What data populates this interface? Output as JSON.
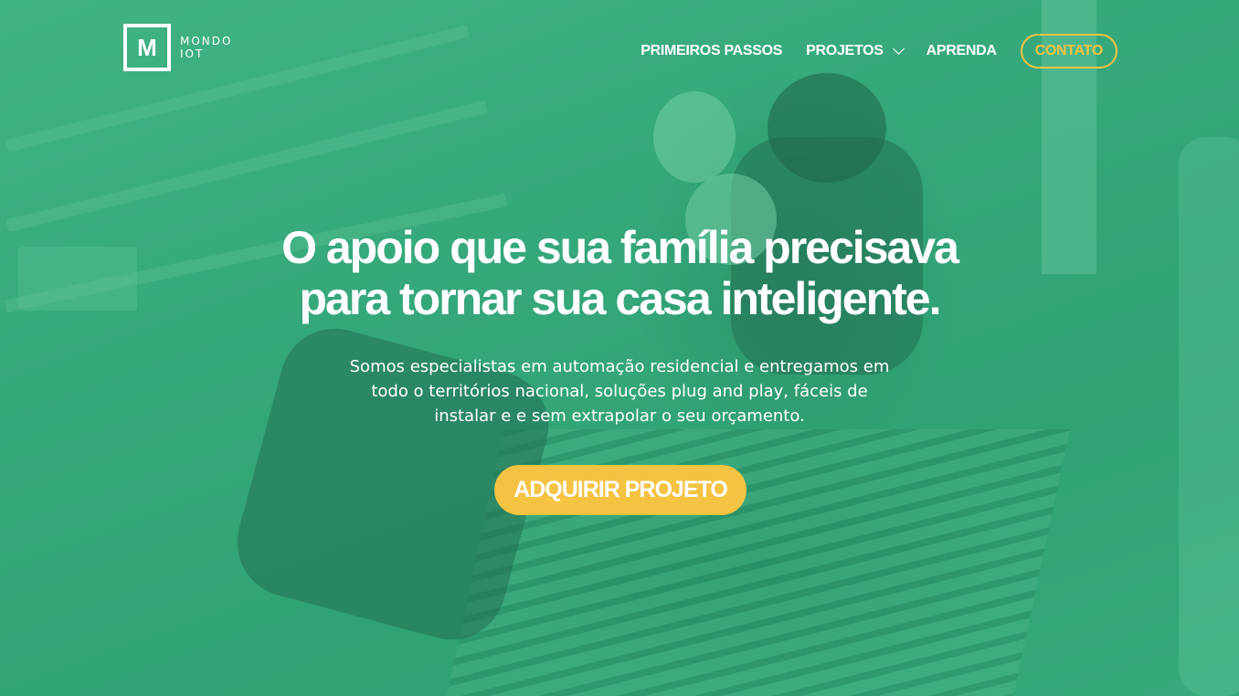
{
  "brand": {
    "logo_letter": "M",
    "name_line1": "MONDO",
    "name_line2": "IOT"
  },
  "nav": {
    "items": [
      {
        "label": "PRIMEIROS PASSOS"
      },
      {
        "label": "PROJETOS",
        "icon": "chevron-down-icon"
      },
      {
        "label": "APRENDA"
      }
    ],
    "contact_label": "CONTATO"
  },
  "hero": {
    "headline_line1": "O apoio que sua família precisava",
    "headline_line2": "para tornar sua casa inteligente.",
    "sub_line1": "Somos especialistas em automação residencial e entregamos em",
    "sub_line2": "todo o territórios nacional, soluções plug and play, fáceis de",
    "sub_line3": "instalar e  e sem extrapolar o seu orçamento.",
    "cta_label": "ADQUIRIR PROJETO"
  },
  "colors": {
    "overlay_green": "#35a679",
    "accent_yellow": "#f5c342",
    "text_white": "#ffffff"
  }
}
